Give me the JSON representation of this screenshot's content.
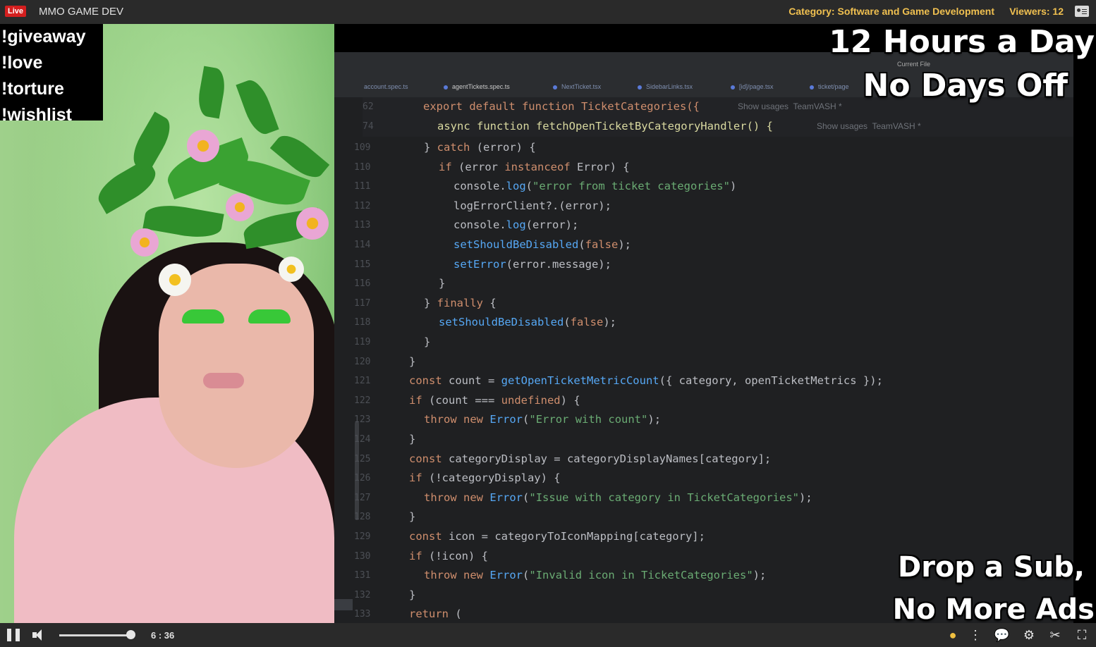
{
  "topbar": {
    "live_label": "Live",
    "channel_title": "MMO GAME DEV",
    "category_label": "Category:",
    "category_value": "Software and Game Development",
    "viewers_label": "Viewers:",
    "viewers_count": "12"
  },
  "chat_commands": [
    "!giveaway",
    "!love",
    "!torture",
    "!wishlist"
  ],
  "overlay": {
    "line1": "12 Hours a Day",
    "line2": "No Days Off",
    "line3": "Drop a Sub,",
    "line4": "No More Ads"
  },
  "ide": {
    "toolbar_label": "Current File",
    "tabs": [
      "account.spec.ts",
      "agentTickets.spec.ts",
      "NextTicket.tsx",
      "SidebarLinks.tsx",
      "[id]/page.tsx",
      "ticket/page"
    ],
    "sticky": [
      {
        "line": "62",
        "code": "export default function TicketCategories({",
        "hint": "Show usages  TeamVASH *"
      },
      {
        "line": "74",
        "code": "async function fetchOpenTicketByCategoryHandler() {",
        "hint": "Show usages  TeamVASH *"
      }
    ],
    "lines": [
      {
        "n": "109",
        "code": "} catch (error) {"
      },
      {
        "n": "110",
        "code": "if (error instanceof Error) {"
      },
      {
        "n": "111",
        "code": "console.log(\"error from ticket categories\")"
      },
      {
        "n": "112",
        "code": "logErrorClient?.(error);"
      },
      {
        "n": "113",
        "code": "console.log(error);"
      },
      {
        "n": "114",
        "code": "setShouldBeDisabled(false);"
      },
      {
        "n": "115",
        "code": "setError(error.message);"
      },
      {
        "n": "116",
        "code": "}"
      },
      {
        "n": "117",
        "code": "} finally {"
      },
      {
        "n": "118",
        "code": "setShouldBeDisabled(false);"
      },
      {
        "n": "119",
        "code": "}"
      },
      {
        "n": "120",
        "code": "}"
      },
      {
        "n": "121",
        "code": "const count = getOpenTicketMetricCount({ category, openTicketMetrics });"
      },
      {
        "n": "122",
        "code": "if (count === undefined) {"
      },
      {
        "n": "123",
        "code": "throw new Error(\"Error with count\");"
      },
      {
        "n": "124",
        "code": "}"
      },
      {
        "n": "125",
        "code": "const categoryDisplay = categoryDisplayNames[category];"
      },
      {
        "n": "126",
        "code": "if (!categoryDisplay) {"
      },
      {
        "n": "127",
        "code": "throw new Error(\"Issue with category in TicketCategories\");"
      },
      {
        "n": "128",
        "code": "}"
      },
      {
        "n": "129",
        "code": "const icon = categoryToIconMapping[category];"
      },
      {
        "n": "130",
        "code": "if (!icon) {"
      },
      {
        "n": "131",
        "code": "throw new Error(\"Invalid icon in TicketCategories\");"
      },
      {
        "n": "132",
        "code": "}"
      },
      {
        "n": "133",
        "code": "return ("
      }
    ]
  },
  "controls": {
    "time": "6 : 36",
    "volume_level": 0.95
  }
}
